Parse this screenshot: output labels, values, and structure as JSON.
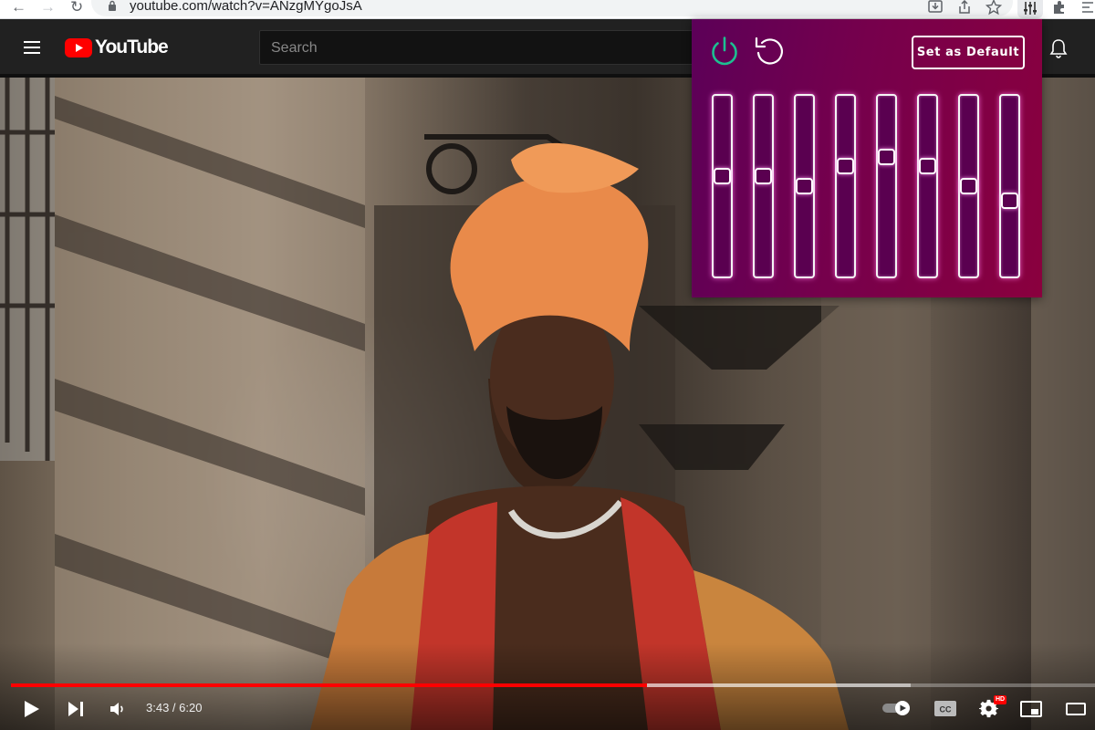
{
  "browser": {
    "url": "youtube.com/watch?v=ANzgMYgoJsA"
  },
  "youtube": {
    "logo_text": "YouTube",
    "search_placeholder": "Search"
  },
  "player": {
    "current_time": "3:43",
    "duration": "6:20",
    "time_text": "3:43 / 6:20",
    "progress_fraction": 0.587,
    "buffered_fraction": 0.83,
    "quality_badge": "HD",
    "colors": {
      "played": "#ff0000"
    }
  },
  "equalizer": {
    "set_default_label": "Set as Default",
    "power_icon": "power-icon",
    "reset_icon": "reset-icon",
    "power_color": "#1dbf91",
    "bands": [
      {
        "level": 0.56
      },
      {
        "level": 0.56
      },
      {
        "level": 0.5
      },
      {
        "level": 0.62
      },
      {
        "level": 0.68
      },
      {
        "level": 0.62
      },
      {
        "level": 0.5
      },
      {
        "level": 0.41
      }
    ]
  }
}
